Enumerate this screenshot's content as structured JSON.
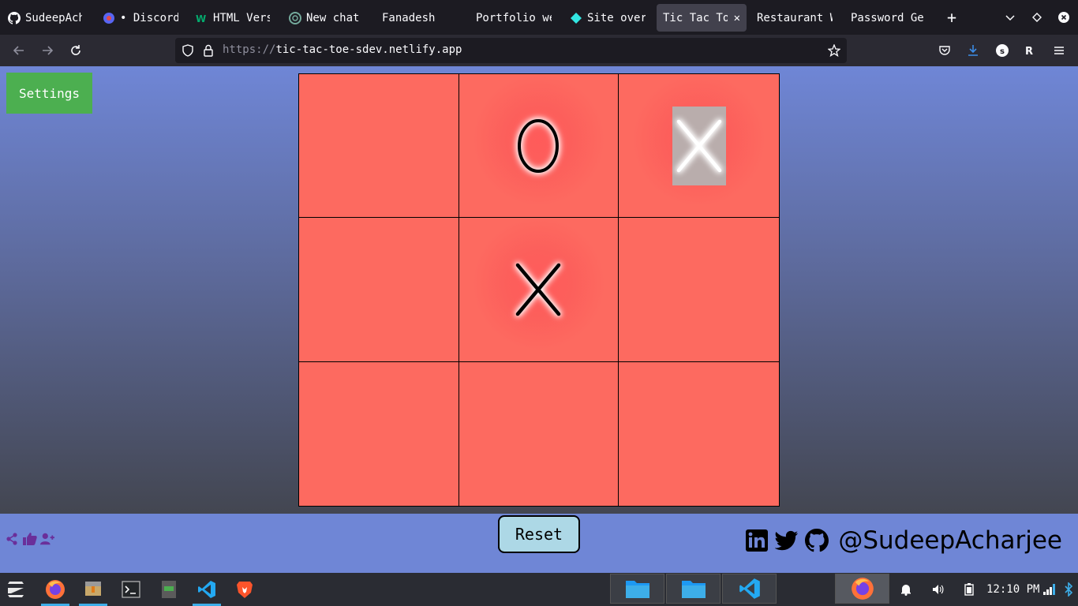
{
  "browser": {
    "tabs": [
      {
        "label": "SudeepAcharjee",
        "icon": "github-icon",
        "active": false
      },
      {
        "label": "• Discord",
        "icon": "discord-icon",
        "active": false
      },
      {
        "label": "HTML Version",
        "icon": "w3schools-icon",
        "active": false
      },
      {
        "label": "New chat",
        "icon": "chatgpt-icon",
        "active": false
      },
      {
        "label": "Fanadesh",
        "icon": "",
        "active": false
      },
      {
        "label": "Portfolio website",
        "icon": "",
        "active": false
      },
      {
        "label": "Site overview",
        "icon": "netlify-icon",
        "active": false
      },
      {
        "label": "Tic Tac Toe",
        "icon": "",
        "active": true
      },
      {
        "label": "Restaurant Website",
        "icon": "",
        "active": false
      },
      {
        "label": "Password Generator",
        "icon": "",
        "active": false
      }
    ],
    "new_tab_symbol": "+",
    "url_protocol": "https://",
    "url_host": "tic-tac-toe-sdev.netlify.app"
  },
  "game": {
    "settings_label": "Settings",
    "board": [
      "",
      "O",
      "X",
      "",
      "X",
      "",
      "",
      "",
      ""
    ],
    "highlighted_cell": 2,
    "reset_label": "Reset"
  },
  "footer": {
    "handle": "@SudeepAcharjee"
  },
  "taskbar": {
    "clock": "12:10 PM"
  },
  "colors": {
    "page_gradient_top": "#6f86d6",
    "board_bg": "#fd6a60",
    "settings_bg": "#4caf50",
    "reset_bg": "#add8e6",
    "footer_bg": "#6f86d6",
    "share_icons": "#6a2f9a"
  }
}
